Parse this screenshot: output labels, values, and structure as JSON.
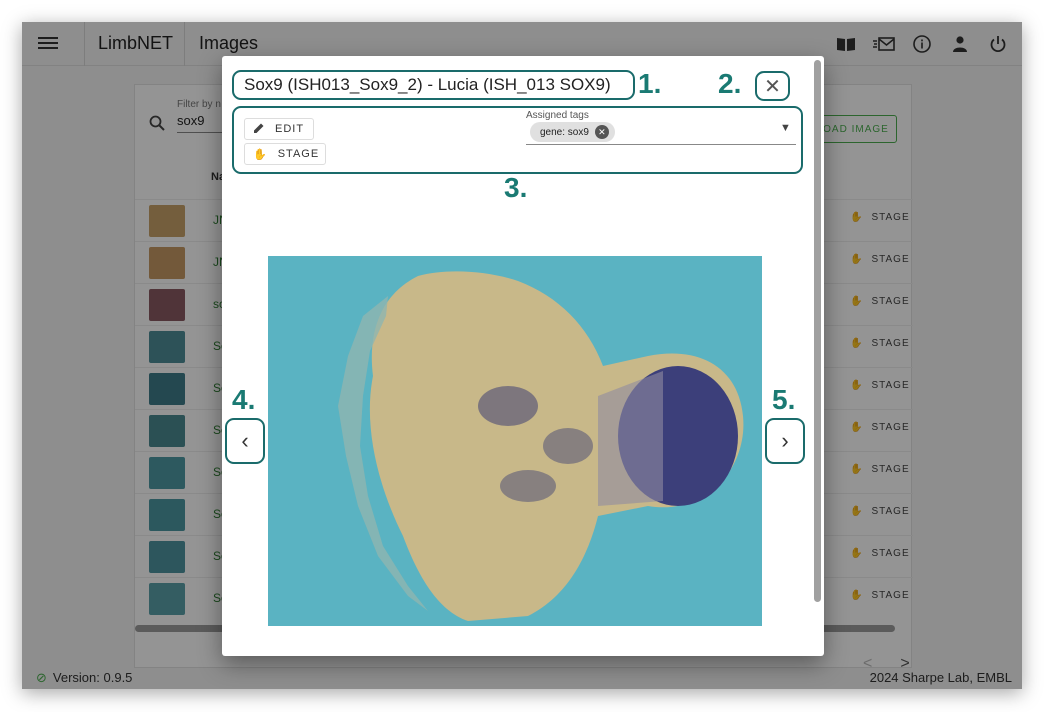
{
  "app": {
    "brand": "LimbNET",
    "section": "Images",
    "icons": [
      "menu-icon",
      "book-icon",
      "mail-icon",
      "info-icon",
      "user-icon",
      "power-icon"
    ]
  },
  "background": {
    "filter_label": "Filter by n",
    "filter_value": "sox9",
    "upload_label": "OAD IMAGE",
    "column_name": "Na",
    "rows": [
      {
        "name": "JN",
        "stage": "STAGE"
      },
      {
        "name": "JN",
        "stage": "STAGE"
      },
      {
        "name": "so",
        "stage": "STAGE"
      },
      {
        "name": "So",
        "stage": "STAGE"
      },
      {
        "name": "So",
        "stage": "STAGE"
      },
      {
        "name": "So (IS",
        "stage": "STAGE"
      },
      {
        "name": "So (IS",
        "stage": "STAGE"
      },
      {
        "name": "So (IS",
        "stage": "STAGE"
      },
      {
        "name": "So (IS",
        "stage": "STAGE"
      },
      {
        "name": "So (IS",
        "stage": "STAGE"
      }
    ],
    "pager_prev": "<",
    "pager_next": ">"
  },
  "footer": {
    "version": "Version: 0.9.5",
    "copyright": "2024 Sharpe Lab, EMBL"
  },
  "dialog": {
    "title": "Sox9 (ISH013_Sox9_2) - Lucia (ISH_013 SOX9)",
    "close_symbol": "✕",
    "edit_label": "EDIT",
    "stage_label": "STAGE",
    "tags_label": "Assigned tags",
    "tags": [
      "gene: sox9"
    ],
    "prev_symbol": "‹",
    "next_symbol": "›",
    "callouts": [
      "1.",
      "2.",
      "3.",
      "4.",
      "5."
    ]
  },
  "colors": {
    "accent": "#1a7a73",
    "green": "#4caf50",
    "image_bg": "#5ab3c2"
  }
}
